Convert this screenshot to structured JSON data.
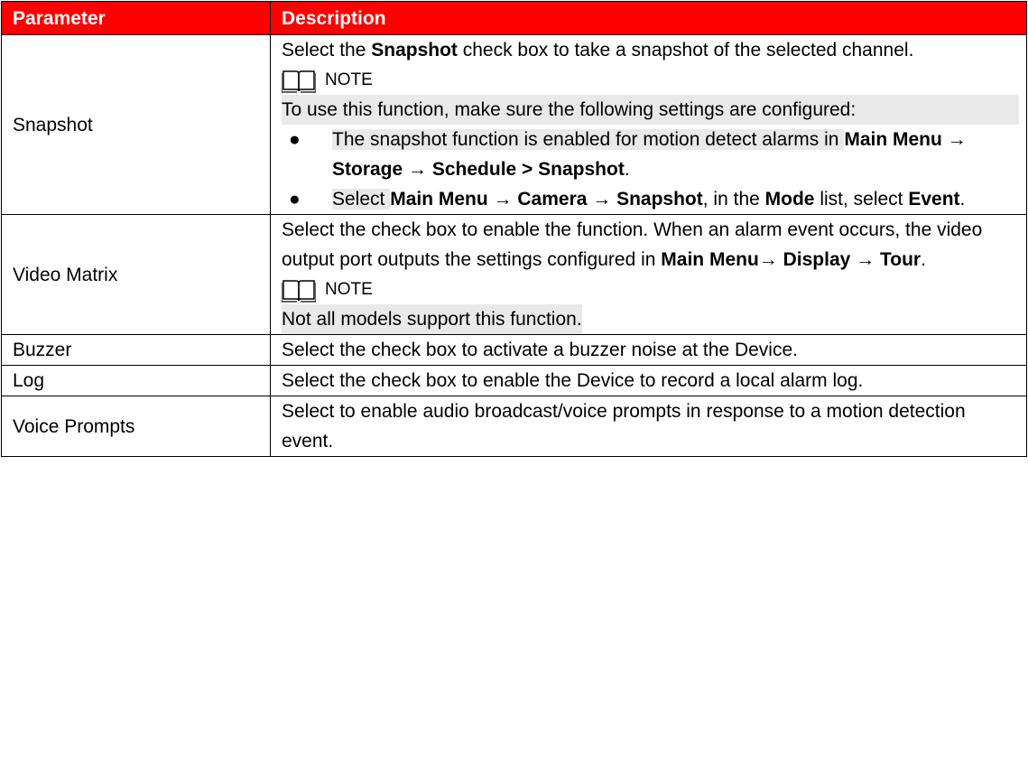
{
  "header": {
    "parameter": "Parameter",
    "description": "Description"
  },
  "snapshot": {
    "param": "Snapshot",
    "line1_pre": "Select the ",
    "line1_b": "Snapshot",
    "line1_post": " check box to take a snapshot of the selected channel.",
    "note_label": "NOTE",
    "note_text": "To use this function, make sure the following settings are configured:",
    "bullet1_text": "The snapshot function is enabled for motion detect alarms in ",
    "bullet1_path": "Main Menu → Storage → Schedule > Snapshot",
    "bullet1_end": ".",
    "bullet2_pre": "Select ",
    "bullet2_path": "Main Menu → Camera → Snapshot",
    "bullet2_mid": ", in the ",
    "bullet2_mode": "Mode",
    "bullet2_mid2": " list, select ",
    "bullet2_event": "Event",
    "bullet2_end": "."
  },
  "video_matrix": {
    "param": "Video Matrix",
    "text": "Select the check box to enable the function. When an alarm event occurs, the video output port outputs the settings configured in ",
    "path": "Main Menu→ Display → Tour",
    "end": ".",
    "note_label": "NOTE",
    "note_text": "Not all models support this function."
  },
  "buzzer": {
    "param": "Buzzer",
    "text": "Select the check box to activate a buzzer noise at the Device."
  },
  "log": {
    "param": "Log",
    "text": "Select the check box to enable the Device to record a local alarm log."
  },
  "voice": {
    "param": "Voice Prompts",
    "text": "Select to enable audio broadcast/voice prompts in response to a motion detection event."
  },
  "colors": {
    "header_bg": "#ff0000",
    "header_text": "#ffffff",
    "highlight": "#e9e9e9"
  },
  "icons": {
    "note": "book-icon",
    "bullet": "bullet-dot"
  }
}
